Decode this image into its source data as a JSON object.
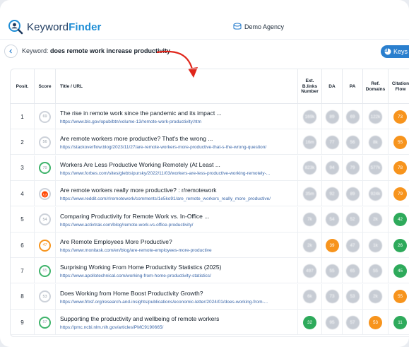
{
  "app": {
    "brand_part1": "Keyword",
    "brand_part2": "Finder",
    "agency": "Demo Agency"
  },
  "search": {
    "label": "Keyword:",
    "keyword": "does remote work increase productivity",
    "keys_button": "Keys"
  },
  "table": {
    "headers": {
      "position": "Posit.",
      "score": "Score",
      "title_url": "Title / URL",
      "ext_backlinks": "Ext. B.links Number",
      "da": "DA",
      "pa": "PA",
      "ref_domains": "Ref. Domains",
      "citation_flow": "Citation Flow"
    },
    "rows": [
      {
        "pos": "1",
        "score": "69",
        "score_color": "gray",
        "title": "The rise in remote work since the pandemic and its impact ...",
        "url": "https://www.bls.gov/opub/btn/volume-13/remote-work-productivity.htm",
        "ext": "169k",
        "ext_c": "gray",
        "da": "89",
        "da_c": "gray",
        "pa": "69",
        "pa_c": "gray",
        "ref": "122k",
        "ref_c": "gray",
        "cf": "73",
        "cf_c": "orange"
      },
      {
        "pos": "2",
        "score": "56",
        "score_color": "gray",
        "title": "Are remote workers more productive? That's the wrong ...",
        "url": "https://stackoverflow.blog/2023/11/27/are-remote-workers-more-productive-that-s-the-wrong-question/",
        "ext": "16m",
        "ext_c": "gray",
        "da": "77",
        "da_c": "gray",
        "pa": "56",
        "pa_c": "gray",
        "ref": "8k",
        "ref_c": "gray",
        "cf": "55",
        "cf_c": "orange"
      },
      {
        "pos": "3",
        "score": "79",
        "score_color": "green",
        "title": "Workers Are Less Productive Working Remotely (At Least ...",
        "url": "https://www.forbes.com/sites/glebtsipursky/2022/11/03/workers-are-less-productive-working-remotely-...",
        "ext": "823k",
        "ext_c": "gray",
        "da": "94",
        "da_c": "gray",
        "pa": "79",
        "pa_c": "gray",
        "ref": "577k",
        "ref_c": "gray",
        "cf": "78",
        "cf_c": "orange"
      },
      {
        "pos": "4",
        "score": "",
        "score_color": "reddit",
        "title": "Are remote workers really more productive? : r/remotework",
        "url": "https://www.reddit.com/r/remotework/comments/1e5ko91/are_remote_workers_really_more_productive/",
        "ext": "35m",
        "ext_c": "gray",
        "da": "92",
        "da_c": "gray",
        "pa": "89",
        "pa_c": "gray",
        "ref": "924k",
        "ref_c": "gray",
        "cf": "79",
        "cf_c": "orange"
      },
      {
        "pos": "5",
        "score": "54",
        "score_color": "gray",
        "title": "Comparing Productivity for Remote Work vs. In-Office ...",
        "url": "https://www.activtrak.com/blog/remote-work-vs-office-productivity/",
        "ext": "7k",
        "ext_c": "gray",
        "da": "54",
        "da_c": "gray",
        "pa": "52",
        "pa_c": "gray",
        "ref": "2k",
        "ref_c": "gray",
        "cf": "42",
        "cf_c": "green"
      },
      {
        "pos": "6",
        "score": "47",
        "score_color": "orange",
        "title": "Are Remote Employees More Productive?",
        "url": "https://www.monitask.com/en/blog/are-remote-employees-more-productive",
        "ext": "2k",
        "ext_c": "gray",
        "da": "39",
        "da_c": "orange",
        "pa": "47",
        "pa_c": "gray",
        "ref": "1k",
        "ref_c": "gray",
        "cf": "26",
        "cf_c": "green"
      },
      {
        "pos": "7",
        "score": "65",
        "score_color": "green",
        "title": "Surprising Working From Home Productivity Statistics (2025)",
        "url": "https://www.apollotechnical.com/working-from-home-productivity-statistics/",
        "ext": "497",
        "ext_c": "gray",
        "da": "55",
        "da_c": "gray",
        "pa": "65",
        "pa_c": "gray",
        "ref": "55",
        "ref_c": "gray",
        "cf": "45",
        "cf_c": "green"
      },
      {
        "pos": "8",
        "score": "53",
        "score_color": "gray",
        "title": "Does Working from Home Boost Productivity Growth?",
        "url": "https://www.frbsf.org/research-and-insights/publications/economic-letter/2024/01/does-working-from-...",
        "ext": "6k",
        "ext_c": "gray",
        "da": "73",
        "da_c": "gray",
        "pa": "53",
        "pa_c": "gray",
        "ref": "2k",
        "ref_c": "gray",
        "cf": "55",
        "cf_c": "orange"
      },
      {
        "pos": "9",
        "score": "57",
        "score_color": "green",
        "title": "Supporting the productivity and wellbeing of remote workers",
        "url": "https://pmc.ncbi.nlm.nih.gov/articles/PMC9190665/",
        "ext": "32",
        "ext_c": "green",
        "da": "95",
        "da_c": "gray",
        "pa": "57",
        "pa_c": "gray",
        "ref": "53",
        "ref_c": "orange",
        "cf": "11",
        "cf_c": "green"
      }
    ]
  },
  "colors": {
    "accent": "#2a7fce",
    "orange": "#f7941d",
    "green": "#2eaa5b",
    "gray": "#c7ccd4",
    "arrow": "#e0261b"
  }
}
